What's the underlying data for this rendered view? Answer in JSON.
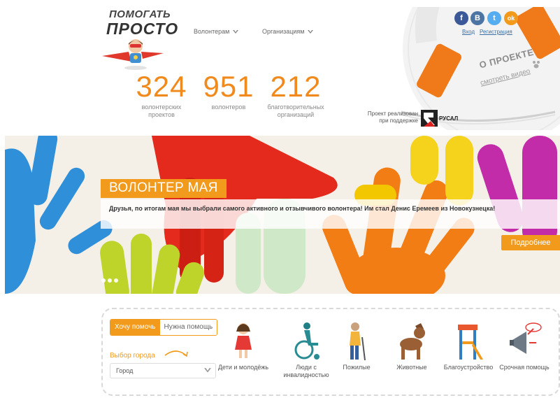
{
  "logo": {
    "line1": "ПОМОГАТЬ",
    "line2": "ПРОСТО"
  },
  "nav": {
    "volunteers": "Волонтерам",
    "organizations": "Организациям"
  },
  "stats": [
    {
      "number": "324",
      "label": "волонтерских проектов"
    },
    {
      "number": "951",
      "label": "волонтеров"
    },
    {
      "number": "212",
      "label": "благотворительных организаций"
    }
  ],
  "sponsor": {
    "text": "Проект реализован при поддержке",
    "brand": "РУСАЛ"
  },
  "social": {
    "fb": "f",
    "vk": "B",
    "tw": "t",
    "ok": "ok"
  },
  "auth": {
    "login": "Вход",
    "register": "Регистрация"
  },
  "about": {
    "title": "О ПРОЕКТЕ",
    "video": "смотреть видео"
  },
  "banner": {
    "title": "ВОЛОНТЕР МАЯ",
    "text": "Друзья, по итогам мая мы выбрали самого активного и отзывчивого волонтера! Им стал Денис Еремеев из Новокузнецка!",
    "more": "Подробнее"
  },
  "search": {
    "tab_help": "Хочу помочь",
    "tab_need": "Нужна помощь",
    "city_label": "Выбор города",
    "city_value": "Город"
  },
  "categories": [
    {
      "label": "Дети и молодёжь",
      "icon": "child-icon"
    },
    {
      "label": "Люди с инвалидностью",
      "icon": "wheelchair-icon"
    },
    {
      "label": "Пожилые",
      "icon": "elderly-icon"
    },
    {
      "label": "Животные",
      "icon": "dog-icon"
    },
    {
      "label": "Благоустройство",
      "icon": "playground-icon"
    },
    {
      "label": "Срочная помощь",
      "icon": "megaphone-sos-icon"
    }
  ],
  "colors": {
    "accent": "#f29a1c",
    "stat": "#f08a1d",
    "link": "#3a6ea5"
  }
}
